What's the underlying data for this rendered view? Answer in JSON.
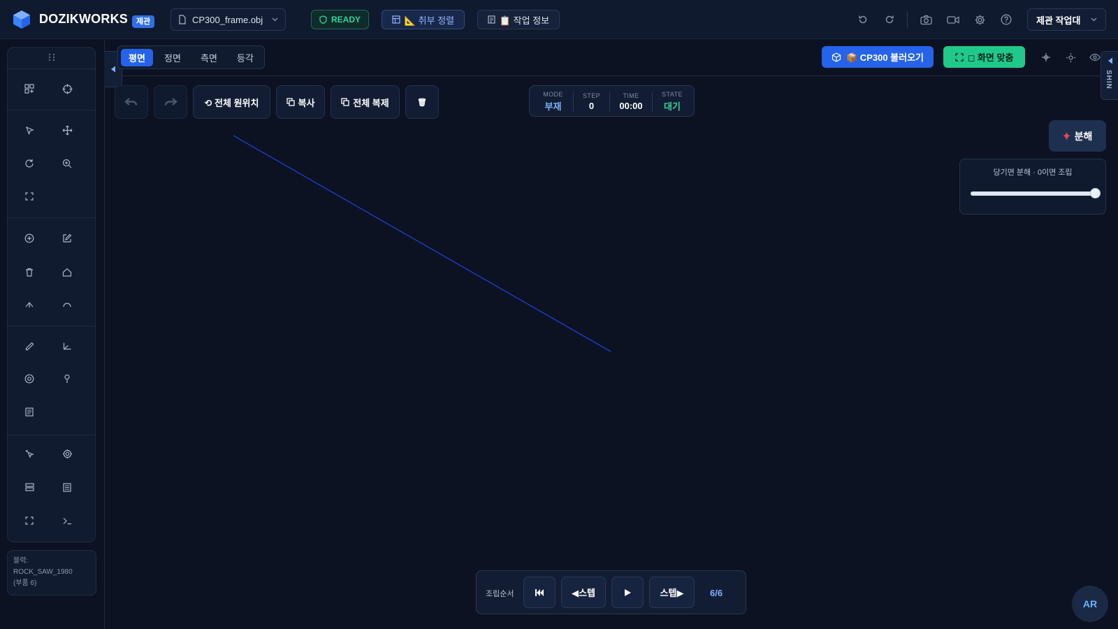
{
  "app": {
    "brand": "DOZIKWORKS",
    "badge": "제관",
    "file_name": "CP300_frame.obj",
    "status": "READY",
    "align_button": "📐 취부 정렬",
    "info_button": "📋 작업 정보",
    "workbench": "제관 작업대"
  },
  "view": {
    "tabs": [
      {
        "label": "평면",
        "active": true
      },
      {
        "label": "정면",
        "active": false
      },
      {
        "label": "측면",
        "active": false
      },
      {
        "label": "등각",
        "active": false
      }
    ],
    "load_button": "📦 CP300 불러오기",
    "fit_button": "◻ 화면 맞춤",
    "side_tab": "SHIN"
  },
  "canvas_toolbar": {
    "reset_position": "⟲ 전체 원위치",
    "copy": "복사",
    "duplicate_all": "전체 복제",
    "delete_icon": "🗑"
  },
  "hud": {
    "mode_label": "MODE",
    "mode_value": "부재",
    "step_label": "STEP",
    "step_value": "0",
    "time_label": "TIME",
    "time_value": "00:00",
    "state_label": "STATE",
    "state_value": "대기",
    "state_color": "#35d39a"
  },
  "explode": {
    "button": "분해",
    "slider_label": "당기면 분해 · 0이면 조립",
    "value": 1.0
  },
  "block_info": {
    "prefix": "블럭:",
    "name": "ROCK_SAW_1980",
    "parts": "(부품 6)"
  },
  "assembly": {
    "label": "조립순서",
    "prev_step": "◀스텝",
    "next_step": "스텝▶",
    "counter": "6/6"
  },
  "ar_button": "AR",
  "left_tools": [
    "grid-add-icon",
    "crosshair-icon",
    "pointer-icon",
    "move-icon",
    "rotate-icon",
    "zoom-in-icon",
    "fullscreen-icon",
    "plus-circle-icon",
    "edit-icon",
    "trash-icon",
    "home-icon",
    "arrow-up-icon",
    "arc-icon",
    "pencil-icon",
    "angle-icon",
    "target-icon",
    "pin-icon",
    "notes-icon",
    "cursor-click-icon",
    "settings-icon",
    "server-icon",
    "document-icon",
    "expand-icon",
    "terminal-icon"
  ],
  "colors": {
    "accent": "#2563eb",
    "success": "#1fc98a",
    "background": "#0c1222",
    "line": "#1d3fd0"
  }
}
